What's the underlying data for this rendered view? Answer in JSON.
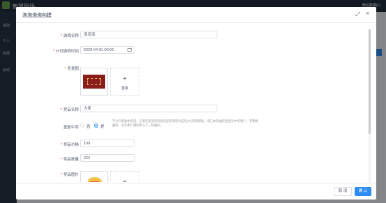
{
  "app": {
    "title": "智慧现场",
    "user": "微信数据(1)"
  },
  "sidebar": {
    "items": [
      "基础",
      "个人",
      "数据",
      "系统"
    ]
  },
  "dialog": {
    "title": "泡泡泡泡创建",
    "fields": {
      "game_name": {
        "label": "游戏名称",
        "value": "泡泡泡"
      },
      "plan_time": {
        "label": "计划游戏时间",
        "value": "2023-04-01 00:00"
      },
      "background": {
        "label": "背景图",
        "upload_label": "替换"
      },
      "prize_name": {
        "label": "奖品名称",
        "value": "大奖"
      },
      "repeat_win": {
        "label": "重复中奖",
        "options": [
          "否",
          "是"
        ],
        "selected": "是",
        "hint": "不允许重复中奖后，在新的泡泡游戏里的该奖项和对应的(大奖和限制)，将在本轮抽奖后显示中奖用户。不需要删除，允许用户继续参与下一轮抽奖。"
      },
      "prize_price": {
        "label": "奖品价格",
        "value": "100"
      },
      "prize_count": {
        "label": "奖品数量",
        "value": "222"
      },
      "prize_image": {
        "label": "奖品图片"
      }
    },
    "buttons": {
      "cancel": "取 消",
      "ok": "确 认"
    }
  }
}
